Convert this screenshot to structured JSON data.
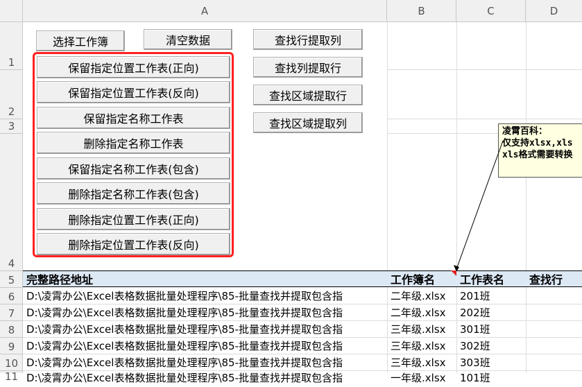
{
  "columns": [
    "A",
    "B",
    "C",
    "D"
  ],
  "rows": [
    "1",
    "2",
    "3",
    "4",
    "5",
    "6",
    "7",
    "8",
    "9",
    "10",
    "11"
  ],
  "buttons": {
    "select_workbook": "选择工作簿",
    "clear_data": "清空数据",
    "lookup_row_extract_col": "查找行提取列",
    "lookup_col_extract_row": "查找列提取行",
    "lookup_area_extract_row": "查找区域提取行",
    "lookup_area_extract_col": "查找区域提取列",
    "group": [
      "保留指定位置工作表(正向)",
      "保留指定位置工作表(反向)",
      "保留指定名称工作表",
      "删除指定名称工作表",
      "保留指定名称工作表(包含)",
      "删除指定名称工作表(包含)",
      "删除指定位置工作表(正向)",
      "删除指定位置工作表(反向)"
    ]
  },
  "comment": {
    "lines": [
      "凌霄百科：",
      "仅支持xlsx,xls",
      "xls格式需要转换"
    ]
  },
  "table": {
    "headers": [
      "完整路径地址",
      "工作簿名",
      "工作表名",
      "查找行"
    ],
    "rows": [
      {
        "path": "D:\\凌霄办公\\Excel表格数据批量处理程序\\85-批量查找并提取包含指",
        "book": "二年级.xlsx",
        "sheet": "201班"
      },
      {
        "path": "D:\\凌霄办公\\Excel表格数据批量处理程序\\85-批量查找并提取包含指",
        "book": "二年级.xlsx",
        "sheet": "202班"
      },
      {
        "path": "D:\\凌霄办公\\Excel表格数据批量处理程序\\85-批量查找并提取包含指",
        "book": "三年级.xlsx",
        "sheet": "301班"
      },
      {
        "path": "D:\\凌霄办公\\Excel表格数据批量处理程序\\85-批量查找并提取包含指",
        "book": "三年级.xlsx",
        "sheet": "302班"
      },
      {
        "path": "D:\\凌霄办公\\Excel表格数据批量处理程序\\85-批量查找并提取包含指",
        "book": "三年级.xlsx",
        "sheet": "303班"
      },
      {
        "path": "D:\\凌霄办公\\Excel表格数据批量处理程序\\85-批量查找并提取包含指",
        "book": "一年级.xlsx",
        "sheet": "101班"
      }
    ]
  },
  "colors": {
    "highlight_frame": "#ff2020",
    "header_fill": "#dde8f5",
    "comment_fill": "#ffffe1"
  }
}
